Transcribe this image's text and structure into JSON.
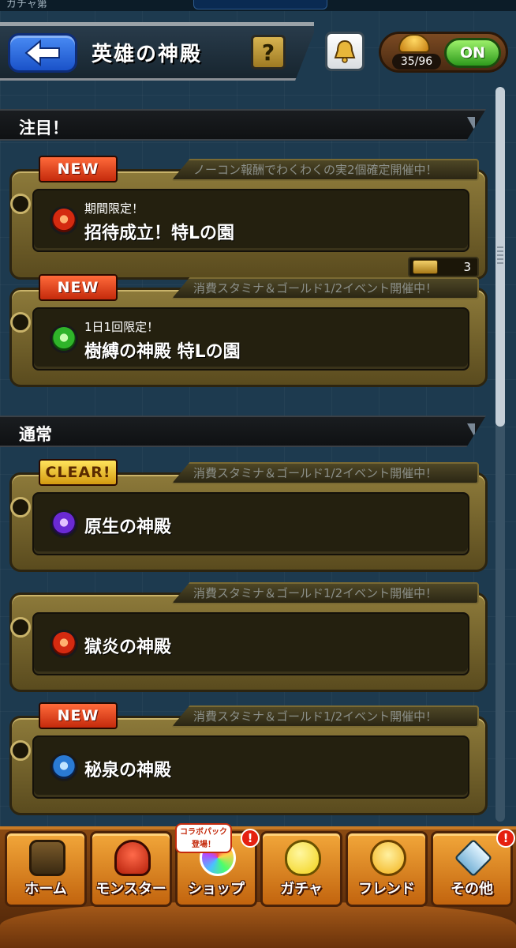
{
  "status_bar": {
    "left_text": "ガチャ第",
    "center_text": ""
  },
  "header": {
    "title": "英雄の神殿",
    "help_label": "?",
    "stamina_count": "35/96",
    "toggle_label": "ON"
  },
  "sections": [
    {
      "label": "注目！",
      "quests": [
        {
          "badge": "NEW",
          "badge_type": "new",
          "banner": "ノーコン報酬でわくわくの実2個確定開催中！",
          "subtitle": "期間限定！",
          "name": "招待成立！特Lの園",
          "element_icon": "fire-orb-icon",
          "ticket_count": "3"
        },
        {
          "badge": "NEW",
          "badge_type": "new",
          "banner": "消費スタミナ＆ゴールド1/2イベント開催中！",
          "subtitle": "1日1回限定！",
          "name": "樹縛の神殿 特Lの園",
          "element_icon": "wood-orb-icon"
        }
      ]
    },
    {
      "label": "通常",
      "quests": [
        {
          "badge": "CLEAR!",
          "badge_type": "clear",
          "banner": "消費スタミナ＆ゴールド1/2イベント開催中！",
          "name": "原生の神殿",
          "element_icon": "dark-orb-icon"
        },
        {
          "badge": "",
          "badge_type": "none",
          "banner": "消費スタミナ＆ゴールド1/2イベント開催中！",
          "name": "獄炎の神殿",
          "element_icon": "fire-orb-icon"
        },
        {
          "badge": "NEW",
          "badge_type": "new",
          "banner": "消費スタミナ＆ゴールド1/2イベント開催中！",
          "name": "秘泉の神殿",
          "element_icon": "water-orb-icon"
        }
      ]
    }
  ],
  "nav": {
    "home": "ホーム",
    "monster": "モンスター",
    "shop": "ショップ",
    "gacha": "ガチャ",
    "friend": "フレンド",
    "other": "その他",
    "collab_badge": "コラボパック登場！",
    "alert_mark": "!"
  },
  "colors": {
    "gold_frame": "#8d7a3a",
    "new_badge": "#e0461e",
    "clear_badge": "#f0c232",
    "nav_orange": "#e08a2a"
  }
}
